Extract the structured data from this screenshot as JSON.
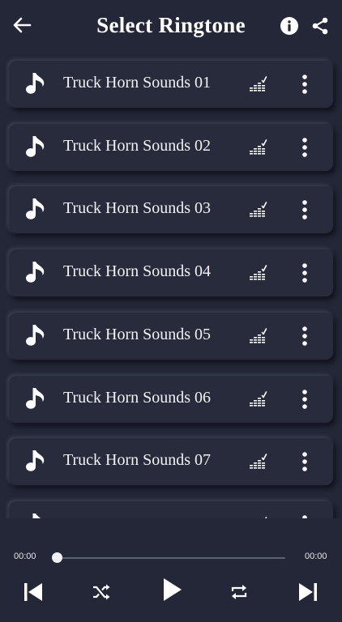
{
  "header": {
    "title": "Select Ringtone",
    "back_icon": "arrow-left-icon",
    "info_icon": "info-icon",
    "share_icon": "share-icon"
  },
  "ringtones": [
    {
      "label": "Truck Horn Sounds 01"
    },
    {
      "label": "Truck Horn Sounds 02"
    },
    {
      "label": "Truck Horn Sounds 03"
    },
    {
      "label": "Truck Horn Sounds 04"
    },
    {
      "label": "Truck Horn Sounds 05"
    },
    {
      "label": "Truck Horn Sounds 06"
    },
    {
      "label": "Truck Horn Sounds 07"
    },
    {
      "label": ""
    }
  ],
  "player": {
    "current_time": "00:00",
    "total_time": "00:00",
    "progress": 0
  },
  "colors": {
    "background": "#232737",
    "card": "#272b3c",
    "text": "#ffffff"
  }
}
